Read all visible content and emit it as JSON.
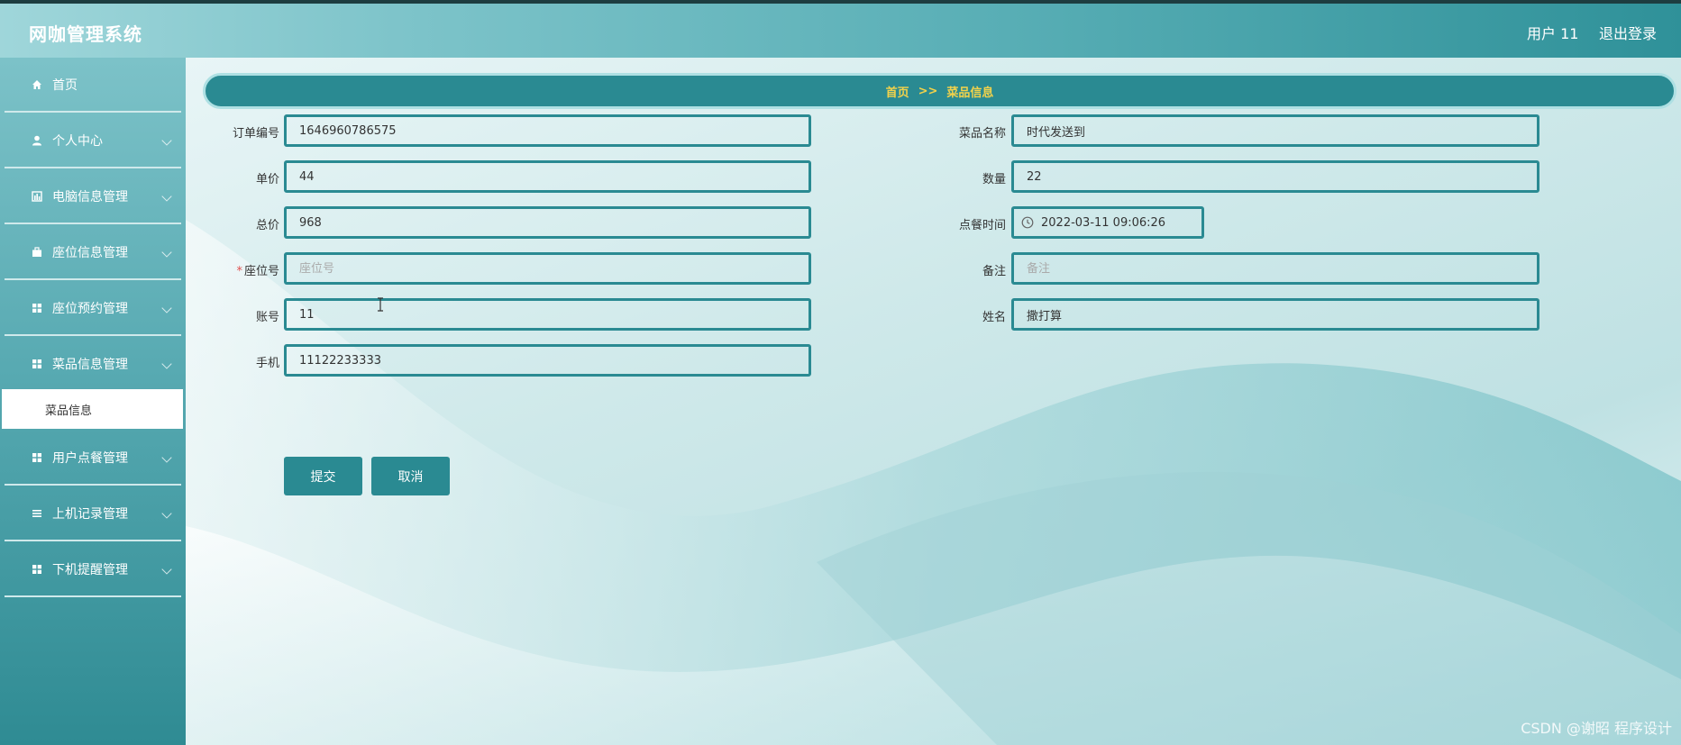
{
  "header": {
    "app_title": "网咖管理系统",
    "user_label": "用户 11",
    "logout_label": "退出登录"
  },
  "sidebar": {
    "items": [
      {
        "label": "首页",
        "icon": "home-icon"
      },
      {
        "label": "个人中心",
        "icon": "user-icon"
      },
      {
        "label": "电脑信息管理",
        "icon": "chart-icon"
      },
      {
        "label": "座位信息管理",
        "icon": "briefcase-icon"
      },
      {
        "label": "座位预约管理",
        "icon": "grid-icon"
      },
      {
        "label": "菜品信息管理",
        "icon": "grid-icon"
      },
      {
        "label": "用户点餐管理",
        "icon": "grid-icon"
      },
      {
        "label": "上机记录管理",
        "icon": "list-icon"
      },
      {
        "label": "下机提醒管理",
        "icon": "grid-icon"
      }
    ],
    "active_sub_item": "菜品信息"
  },
  "breadcrumb": {
    "home": "首页",
    "separator": ">>",
    "current": "菜品信息"
  },
  "form": {
    "order_no": {
      "label": "订单编号",
      "value": "1646960786575"
    },
    "dish_name": {
      "label": "菜品名称",
      "value": "时代发送到"
    },
    "unit_price": {
      "label": "单价",
      "value": "44"
    },
    "quantity": {
      "label": "数量",
      "value": "22"
    },
    "total_price": {
      "label": "总价",
      "value": "968"
    },
    "order_time": {
      "label": "点餐时间",
      "value": "2022-03-11 09:06:26"
    },
    "seat_no": {
      "label": "座位号",
      "placeholder": "座位号",
      "required": "*"
    },
    "remark": {
      "label": "备注",
      "placeholder": "备注"
    },
    "account": {
      "label": "账号",
      "value": "11"
    },
    "name": {
      "label": "姓名",
      "value": "撒打算"
    },
    "phone": {
      "label": "手机",
      "value": "11122233333"
    }
  },
  "buttons": {
    "submit": "提交",
    "cancel": "取消"
  },
  "watermark": "CSDN @谢昭  程序设计",
  "colors": {
    "primary": "#2a8a92",
    "breadcrumb_text": "#f2d24b",
    "required": "#e05050"
  }
}
